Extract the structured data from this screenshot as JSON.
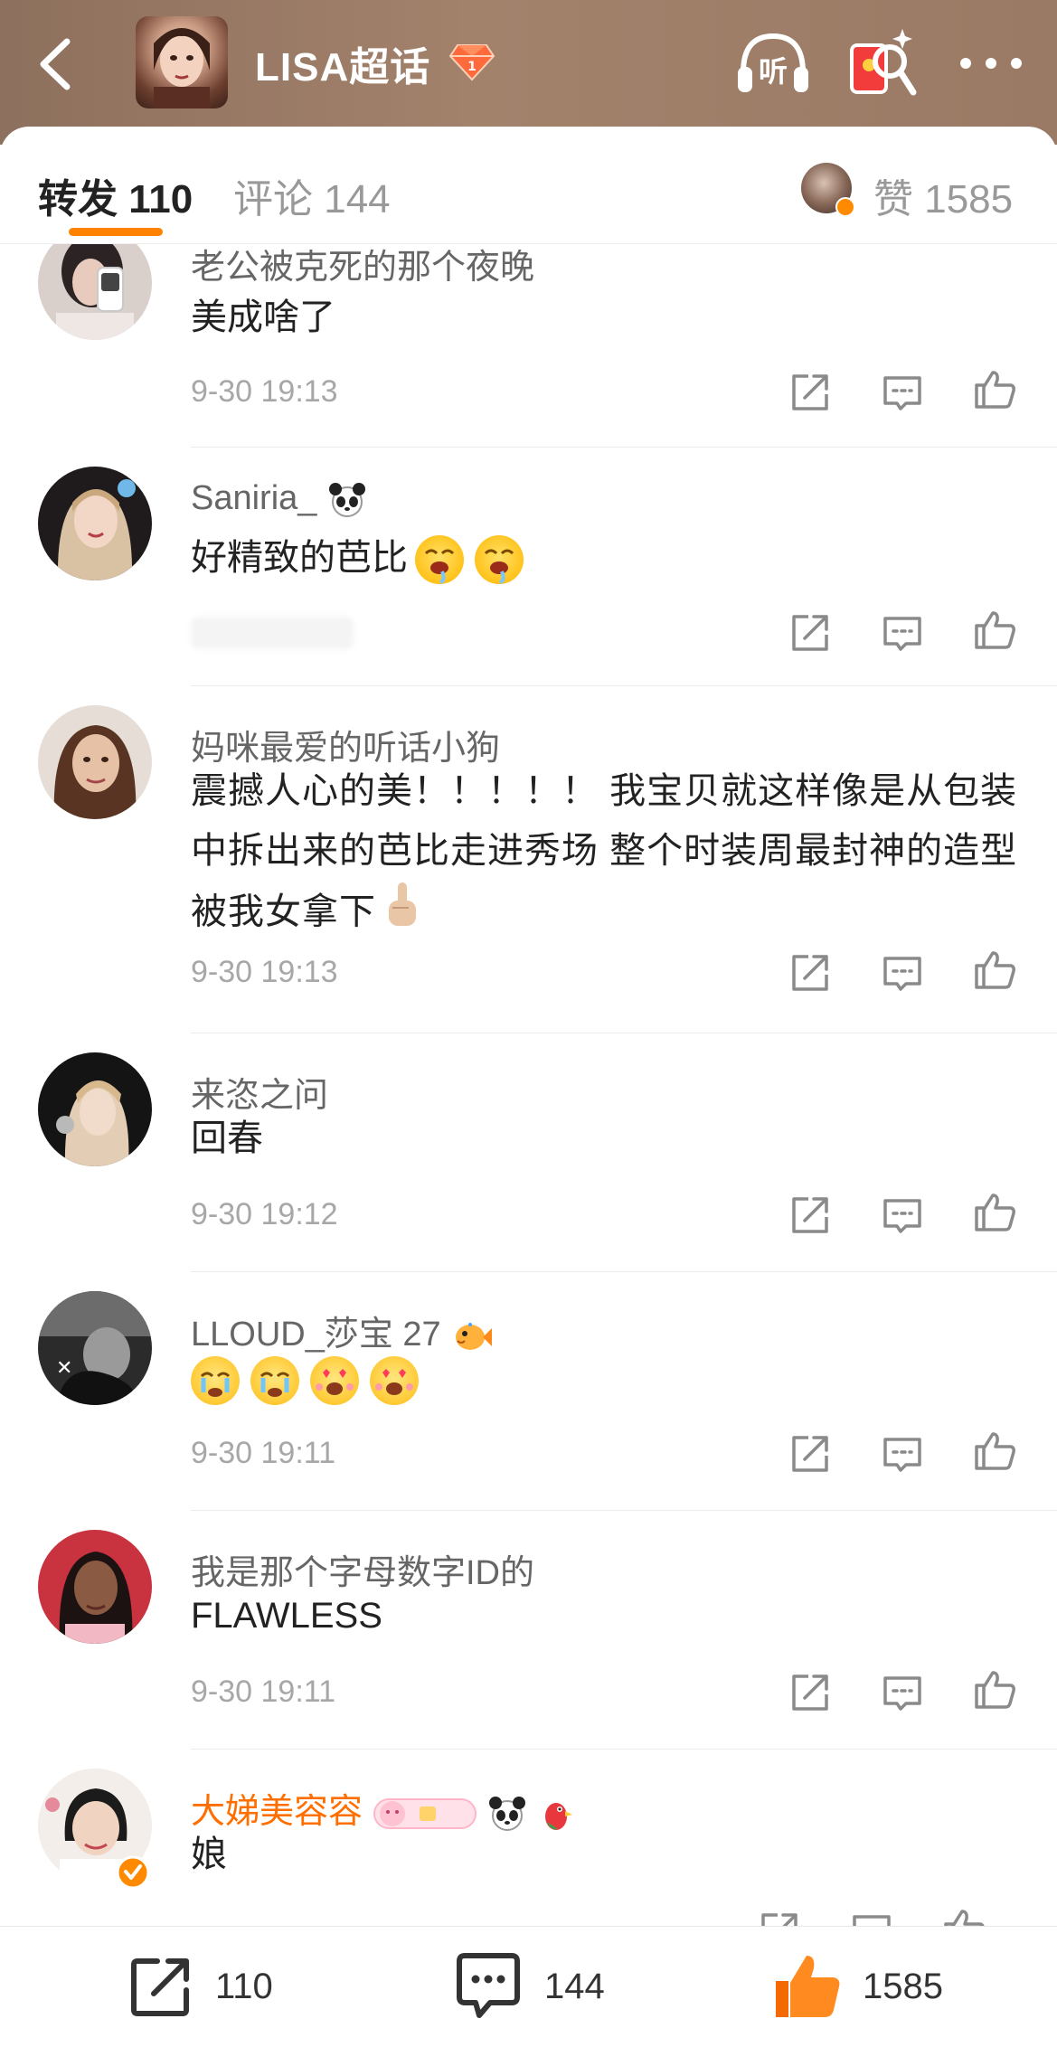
{
  "header": {
    "topic_title": "LISA超话",
    "icons": {
      "back": "chevron-left-icon",
      "badge": "gem-icon",
      "listen": "headphones-listen-icon",
      "listen_label": "听",
      "redpack": "red-packet-search-icon",
      "more": "more-dots-icon"
    }
  },
  "tabs": {
    "repost": "转发 110",
    "comment": "评论 144",
    "likes": "赞 1585"
  },
  "comments": [
    {
      "user": "老公被克死的那个夜晚",
      "text": "美成啥了",
      "time": "9-30 19:13"
    },
    {
      "user": "Saniria_",
      "text": "好精致的芭比",
      "time": ""
    },
    {
      "user": "妈咪最爱的听话小狗",
      "text": "震撼人心的美！！！！！ 我宝贝就这样像是从包装中拆出来的芭比走进秀场 整个时装周最封神的造型被我女拿下",
      "time": "9-30 19:13"
    },
    {
      "user": "来恣之问",
      "text": "回春",
      "time": "9-30 19:12"
    },
    {
      "user": "LLOUD_莎宝 27",
      "text": "",
      "time": "9-30 19:11"
    },
    {
      "user": "我是那个字母数字ID的",
      "text": "FLAWLESS",
      "time": "9-30 19:11"
    },
    {
      "user": "大娣美容容",
      "text": "娘",
      "time": ""
    }
  ],
  "bottom_bar": {
    "repost_count": "110",
    "comment_count": "144",
    "like_count": "1585"
  },
  "colors": {
    "accent": "#ff8200",
    "vip_name": "#ff6f00",
    "header_bg": "#9a7a64"
  }
}
